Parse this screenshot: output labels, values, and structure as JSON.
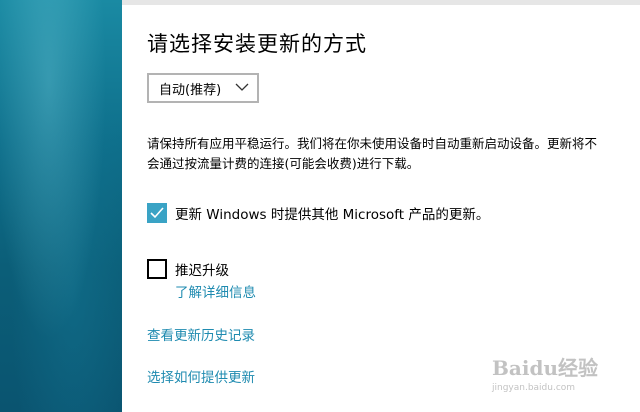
{
  "settings": {
    "title": "请选择安装更新的方式",
    "dropdown": {
      "selected": "自动(推荐)"
    },
    "description": "请保持所有应用平稳运行。我们将在你未使用设备时自动重新启动设备。更新将不会通过按流量计费的连接(可能会收费)进行下载。",
    "options": [
      {
        "label": "更新 Windows 时提供其他 Microsoft 产品的更新。",
        "checked": true
      },
      {
        "label": "推迟升级",
        "checked": false
      }
    ],
    "links": {
      "learn_more": "了解详细信息",
      "view_history": "查看更新历史记录",
      "choose_delivery": "选择如何提供更新"
    }
  },
  "watermark": {
    "brand": "Baidu经验",
    "url": "jingyan.baidu.com"
  },
  "colors": {
    "accent": "#3aa3c5",
    "link": "#1f8bb0",
    "backdrop": "#0e6f8b"
  }
}
